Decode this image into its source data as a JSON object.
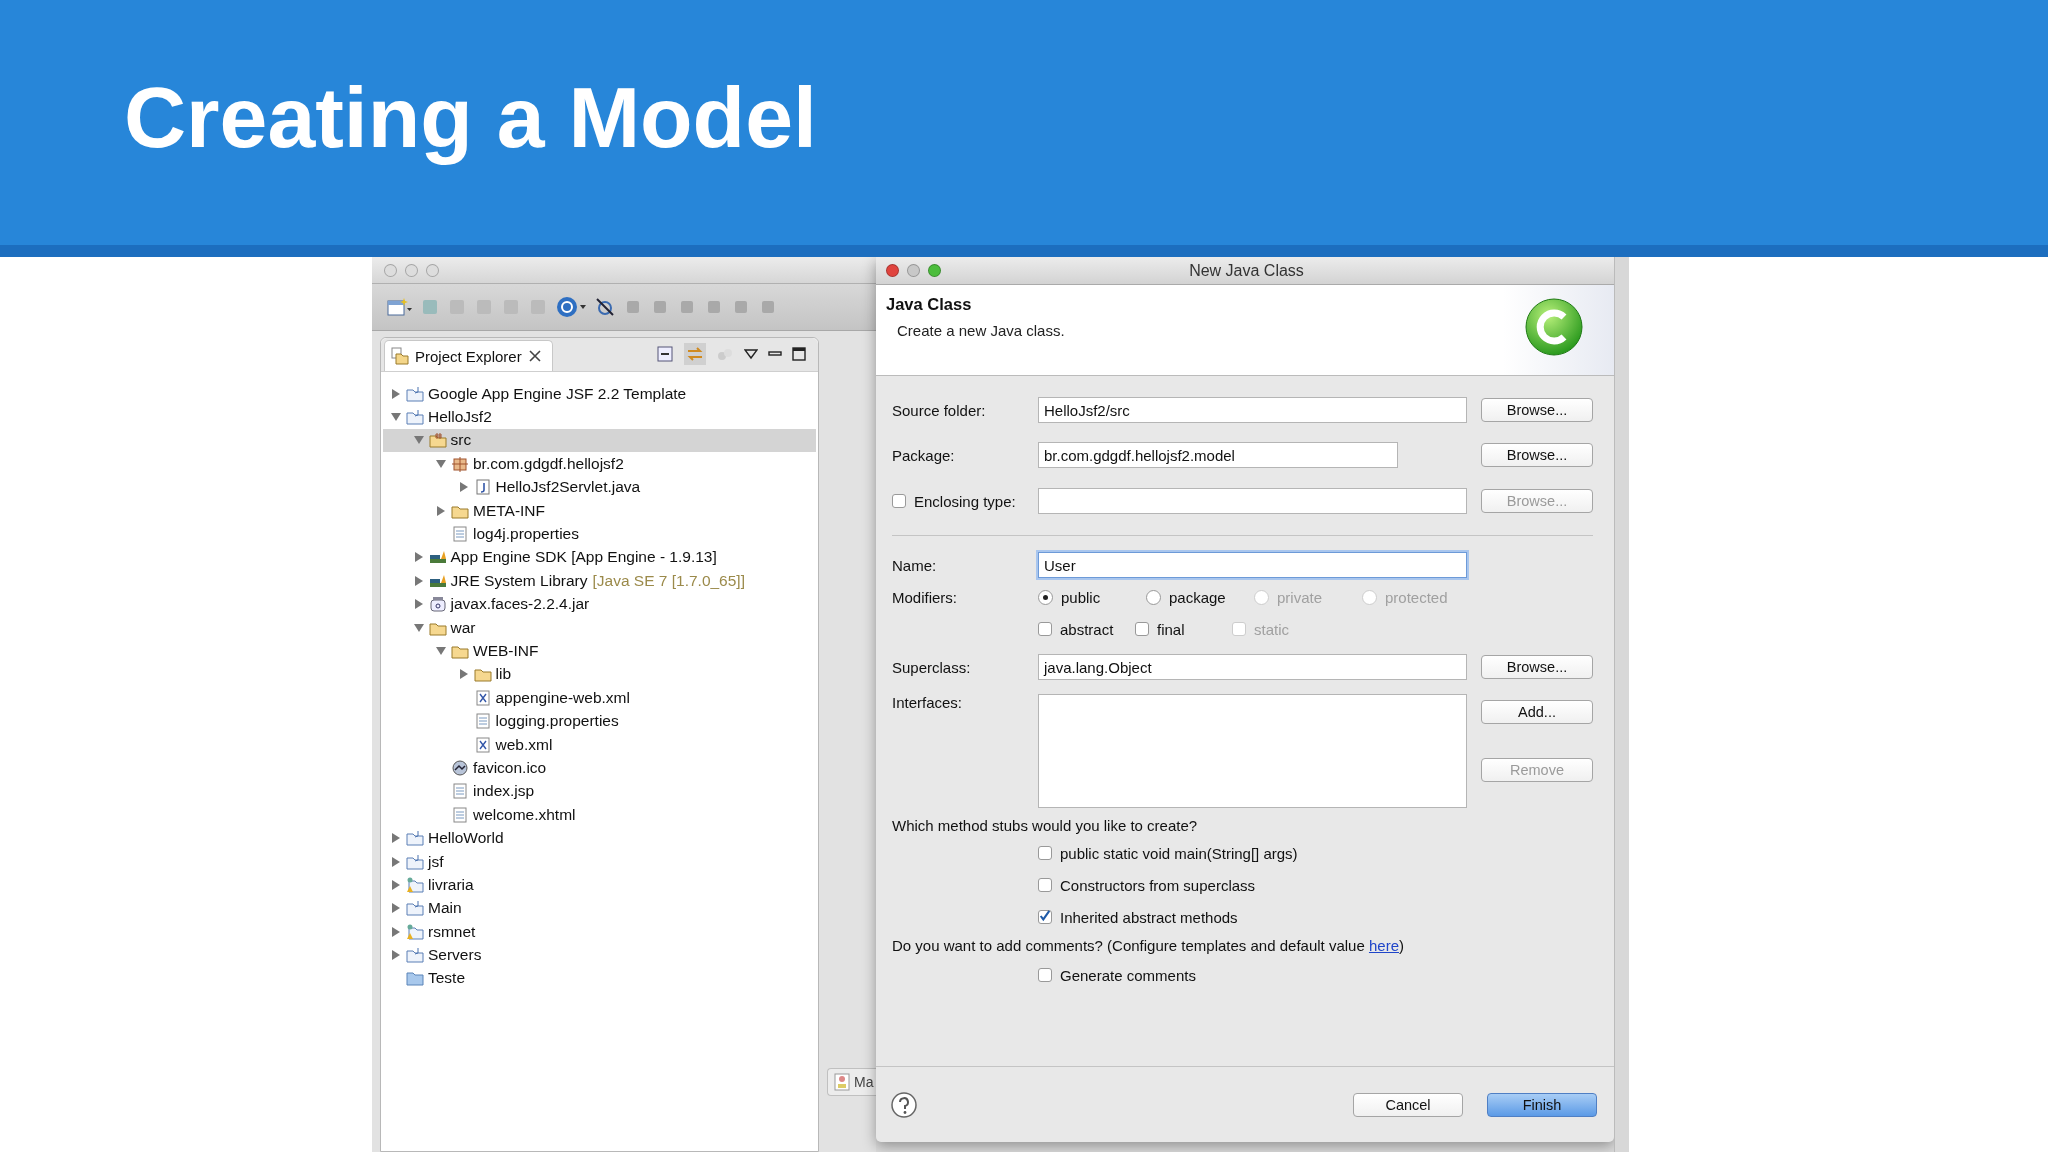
{
  "slide": {
    "title": "Creating a Model"
  },
  "explorer": {
    "tab": "Project Explorer",
    "tree": [
      {
        "label": "Google App Engine JSF 2.2 Template",
        "kind": "project",
        "expanded": false,
        "selected": false
      },
      {
        "label": "HelloJsf2",
        "kind": "project",
        "expanded": true,
        "selected": false,
        "children": [
          {
            "label": "src",
            "kind": "source",
            "expanded": true,
            "selected": true,
            "children": [
              {
                "label": "br.com.gdgdf.hellojsf2",
                "kind": "package",
                "expanded": true,
                "selected": false,
                "children": [
                  {
                    "label": "HelloJsf2Servlet.java",
                    "kind": "java",
                    "expanded": false,
                    "selected": false
                  }
                ]
              },
              {
                "label": "META-INF",
                "kind": "folder",
                "expanded": false,
                "selected": false
              },
              {
                "label": "log4j.properties",
                "kind": "file",
                "selected": false
              }
            ]
          },
          {
            "label": "App Engine SDK [App Engine - 1.9.13]",
            "kind": "library",
            "expanded": false,
            "selected": false
          },
          {
            "label": "JRE System Library",
            "detail": "[Java SE 7 [1.7.0_65]]",
            "kind": "library",
            "expanded": false,
            "selected": false
          },
          {
            "label": "javax.faces-2.2.4.jar",
            "kind": "jar",
            "expanded": false,
            "selected": false
          },
          {
            "label": "war",
            "kind": "folder",
            "expanded": true,
            "selected": false,
            "children": [
              {
                "label": "WEB-INF",
                "kind": "folder",
                "expanded": true,
                "selected": false,
                "children": [
                  {
                    "label": "lib",
                    "kind": "folder",
                    "expanded": false,
                    "selected": false
                  },
                  {
                    "label": "appengine-web.xml",
                    "kind": "xml",
                    "selected": false
                  },
                  {
                    "label": "logging.properties",
                    "kind": "file",
                    "selected": false
                  },
                  {
                    "label": "web.xml",
                    "kind": "xml",
                    "selected": false
                  }
                ]
              },
              {
                "label": "favicon.ico",
                "kind": "image",
                "selected": false
              },
              {
                "label": "index.jsp",
                "kind": "file",
                "selected": false
              },
              {
                "label": "welcome.xhtml",
                "kind": "file",
                "selected": false
              }
            ]
          }
        ]
      },
      {
        "label": "HelloWorld",
        "kind": "project",
        "expanded": false,
        "selected": false
      },
      {
        "label": "jsf",
        "kind": "project",
        "expanded": false,
        "selected": false
      },
      {
        "label": "livraria",
        "kind": "warning",
        "expanded": false,
        "selected": false
      },
      {
        "label": "Main",
        "kind": "project",
        "expanded": false,
        "selected": false
      },
      {
        "label": "rsmnet",
        "kind": "warning",
        "expanded": false,
        "selected": false
      },
      {
        "label": "Servers",
        "kind": "project",
        "expanded": false,
        "selected": false
      },
      {
        "label": "Teste",
        "kind": "plain",
        "selected": false
      }
    ]
  },
  "background_tab": {
    "label": "Ma"
  },
  "dialog": {
    "title": "New Java Class",
    "heading": "Java Class",
    "description": "Create a new Java class.",
    "source_folder": {
      "label": "Source folder:",
      "value": "HelloJsf2/src",
      "button": {
        "label": "Browse...",
        "disabled": false
      }
    },
    "package": {
      "label": "Package:",
      "value": "br.com.gdgdf.hellojsf2.model",
      "button": {
        "label": "Browse...",
        "disabled": false
      }
    },
    "enclosing_type": {
      "label": "Enclosing type:",
      "checked": false,
      "button": {
        "label": "Browse...",
        "disabled": true
      }
    },
    "name": {
      "label": "Name:",
      "value": "User",
      "focused": true
    },
    "modifiers": {
      "label": "Modifiers:",
      "access": [
        {
          "label": "public",
          "selected": true,
          "disabled": false
        },
        {
          "label": "package",
          "selected": false,
          "disabled": false
        },
        {
          "label": "private",
          "selected": false,
          "disabled": true
        },
        {
          "label": "protected",
          "selected": false,
          "disabled": true
        }
      ],
      "flags": [
        {
          "label": "abstract",
          "checked": false,
          "disabled": false
        },
        {
          "label": "final",
          "checked": false,
          "disabled": false
        },
        {
          "label": "static",
          "checked": false,
          "disabled": true
        }
      ]
    },
    "superclass": {
      "label": "Superclass:",
      "value": "java.lang.Object",
      "button": {
        "label": "Browse...",
        "disabled": false
      }
    },
    "interfaces": {
      "label": "Interfaces:",
      "buttons": [
        {
          "label": "Add...",
          "disabled": false
        },
        {
          "label": "Remove",
          "disabled": true
        }
      ]
    },
    "stubs": {
      "question": "Which method stubs would you like to create?",
      "options": [
        {
          "label": "public static void main(String[] args)",
          "checked": false
        },
        {
          "label": "Constructors from superclass",
          "checked": false
        },
        {
          "label": "Inherited abstract methods",
          "checked": true
        }
      ]
    },
    "comments": {
      "prompt": "Do you want to add comments? (Configure templates and default value ",
      "link": "here",
      "prompt_end": ")",
      "option": {
        "label": "Generate comments",
        "checked": false
      }
    },
    "buttons": [
      {
        "label": "Cancel",
        "default": false
      },
      {
        "label": "Finish",
        "default": true
      }
    ]
  }
}
